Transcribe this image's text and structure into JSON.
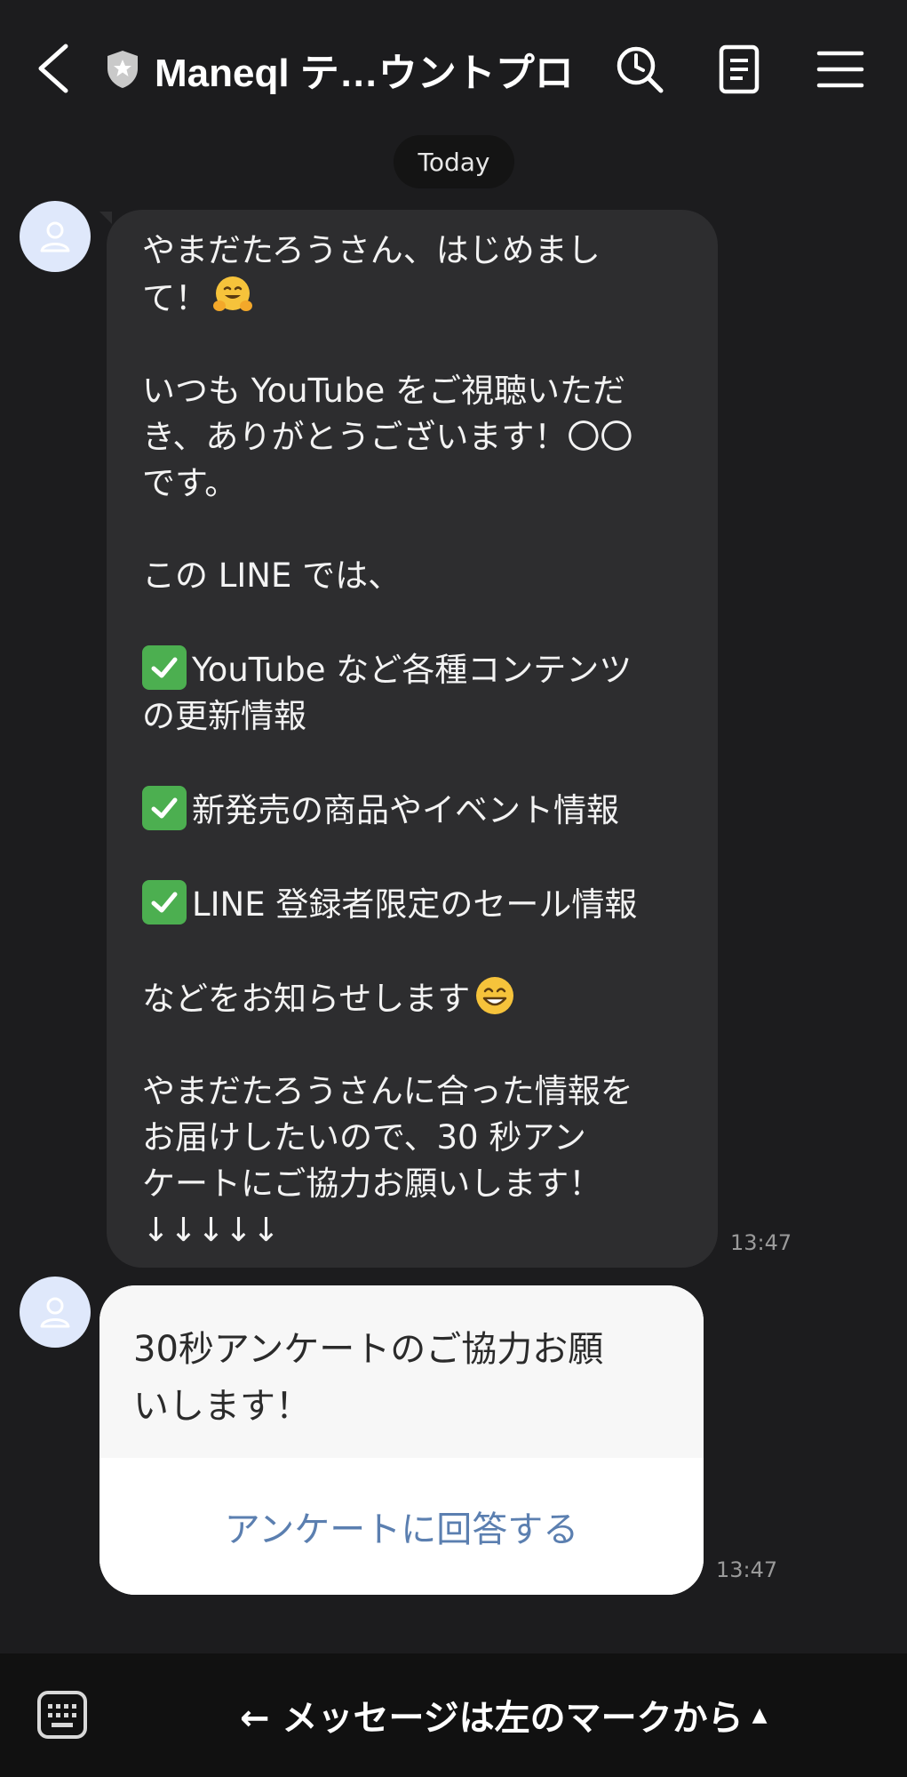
{
  "header": {
    "title": "Maneql テ…ウントプロ",
    "icons": [
      "back-chevron-icon",
      "shield-star-icon",
      "search-icon",
      "note-icon",
      "menu-icon"
    ]
  },
  "chat": {
    "date_chip": "Today",
    "message1": {
      "lines": [
        "やまだたろうさん、はじめまし",
        "て！",
        "",
        "いつも YouTube をご視聴いただ",
        "き、ありがとうございます！〇〇",
        "です。",
        "",
        "この LINE では、",
        "",
        "YouTube など各種コンテンツ",
        "の更新情報",
        "",
        "新発売の商品やイベント情報",
        "",
        "LINE 登録者限定のセール情報",
        "",
        "などをお知らせします",
        "",
        "やまだたろうさんに合った情報を",
        "お届けしたいので、30 秒アン",
        "ケートにご協力お願いします！",
        "↓↓↓↓↓"
      ],
      "time": "13:47"
    },
    "message2": {
      "lines": [
        "30秒アンケートのご協力お願",
        "いします！"
      ],
      "button_label": "アンケートに回答する",
      "time": "13:47"
    }
  },
  "footer": {
    "text": "← メッセージは左のマークから",
    "triangle": "▲"
  },
  "colors": {
    "background": "#1c1c1e",
    "bubble": "#2d2d2f",
    "footer": "#111111",
    "link": "#5b7fb0",
    "check": "#4caf50",
    "avatar": "#dfe8fb"
  }
}
